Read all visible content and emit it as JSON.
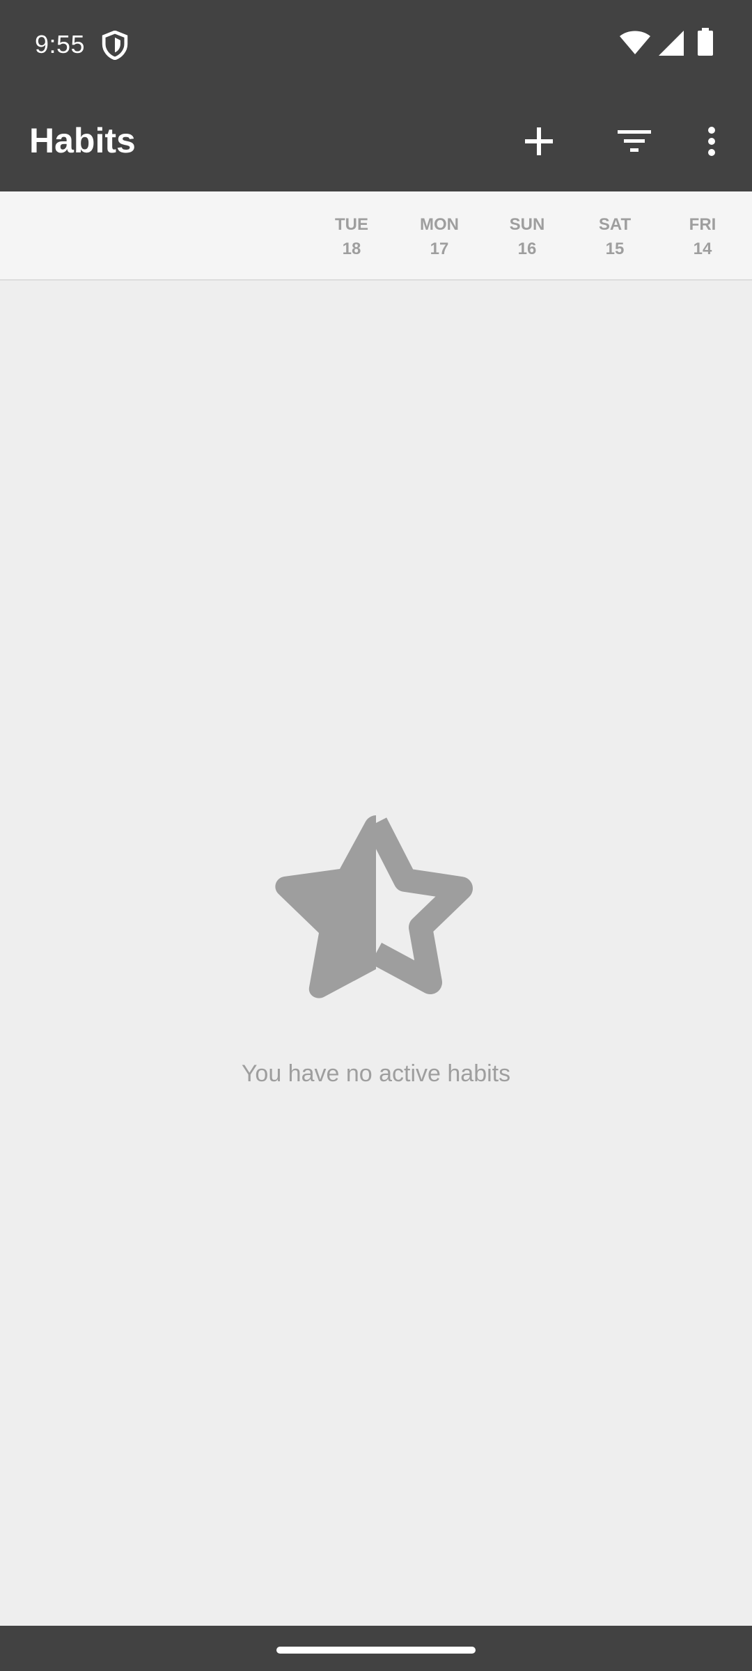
{
  "status_bar": {
    "time": "9:55",
    "icons": [
      "shield-icon",
      "wifi-icon",
      "signal-icon",
      "battery-icon"
    ]
  },
  "app_bar": {
    "title": "Habits",
    "actions": [
      "add-icon",
      "filter-icon",
      "more-vert-icon"
    ]
  },
  "days": [
    {
      "weekday": "TUE",
      "date": "18"
    },
    {
      "weekday": "MON",
      "date": "17"
    },
    {
      "weekday": "SUN",
      "date": "16"
    },
    {
      "weekday": "SAT",
      "date": "15"
    },
    {
      "weekday": "FRI",
      "date": "14"
    }
  ],
  "empty_state": {
    "icon": "star-half-icon",
    "message": "You have no active habits"
  },
  "colors": {
    "toolbar": "#424242",
    "background": "#eeeeee",
    "header": "#f5f5f5",
    "muted_text": "#9e9e9e"
  }
}
